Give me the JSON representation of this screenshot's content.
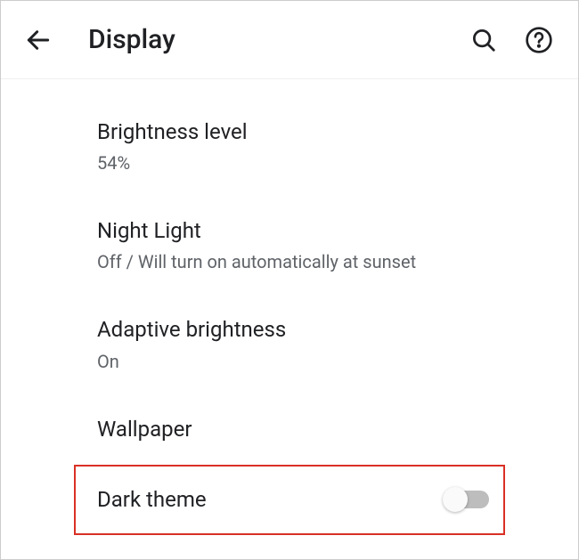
{
  "header": {
    "title": "Display"
  },
  "settings": {
    "brightness": {
      "title": "Brightness level",
      "value": "54%"
    },
    "nightLight": {
      "title": "Night Light",
      "value": "Off / Will turn on automatically at sunset"
    },
    "adaptive": {
      "title": "Adaptive brightness",
      "value": "On"
    },
    "wallpaper": {
      "title": "Wallpaper"
    },
    "darkTheme": {
      "title": "Dark theme",
      "enabled": false
    }
  }
}
